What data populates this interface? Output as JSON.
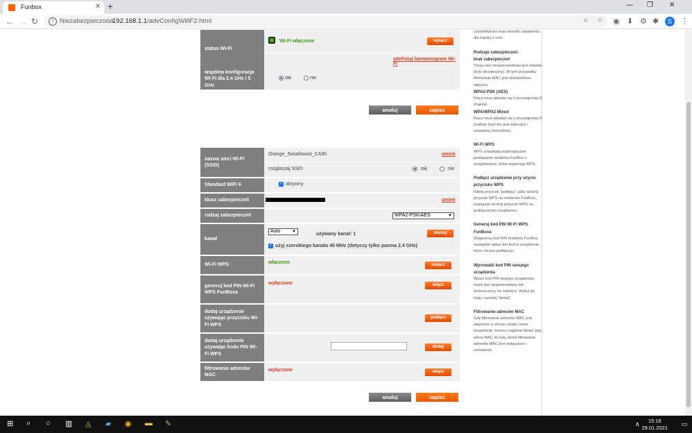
{
  "browser": {
    "tab_title": "Funbox",
    "tab_close": "✕",
    "new_tab": "+",
    "insecure_label": "Niezabezpieczona",
    "url_host": "192.168.1.1",
    "url_path": "/advConfigWifiF2.html"
  },
  "section1": {
    "status_label": "status Wi-Fi",
    "status_value": "Wi-Fi włączone",
    "status_button": "wyłącz",
    "schedule_link": "zdefiniuj harmonogram Wi-Fi",
    "common_label": "wspólna konfiguracja Wi-Fi dla 2.4 GHz i 5 GHz",
    "radio_yes": "tak",
    "radio_no": "nie",
    "cancel": "anuluj",
    "save": "zapisz"
  },
  "section2": {
    "ssid_label": "nazwa sieci Wi-Fi (SSID)",
    "ssid_value": "Orange_Swiatlowod_CA90",
    "ssid_change": "zmień",
    "broadcast_label": "rozgłaszaj SSID",
    "broadcast_yes": "tak",
    "broadcast_no": "nie",
    "wifi6_label": "Standard WiFi 6",
    "wifi6_value": "aktywny",
    "key_label": "klucz zabezpieczeń",
    "key_change": "zmień",
    "sec_type_label": "rodzaj zabezpieczeń",
    "sec_type_value": "WPA2-PSK/AES",
    "channel_label": "kanał",
    "channel_value": "Auto",
    "channel_used": "używany kanał: 1",
    "scan_button": "skanuj",
    "wide_channel": "użyj szerokiego kanału 40 MHz (dotyczy tylko pasma 2.4 GHz)",
    "wps_label": "Wi-Fi WPS",
    "wps_value": "włączone",
    "wps_button": "wyłącz",
    "pin_label": "generuj kod PIN Wi-Fi WPS FunBoxa",
    "pin_value": "wyłączone",
    "pin_button": "włącz",
    "add_btn_label": "dodaj urządzenie używając przycisku Wi-Fi WPS",
    "add_btn_button": "podłącz",
    "add_pin_label": "dodaj urządzenie używając kodu PIN Wi-Fi WPS",
    "add_pin_button": "dodaj",
    "mac_label": "filtrowanie adresów MAC",
    "mac_value": "wyłączone",
    "mac_button": "włącz",
    "cancel": "anuluj",
    "save": "zapisz"
  },
  "help": {
    "intro": "wybrać, czy chcesz mieć dostępne obie częstotliwości oraz określić ustawienia dla każdej z nich.",
    "sec_title": "Rodzaje zabezpieczeń:",
    "none_title": "brak zabezpieczeń",
    "none_text": "Twoja sieć bezprzewodowa jest otwarta (tryb niezalecany). W tym przypadku filtrowanie MAC jest standardowo włączon.",
    "wpa2_title": "WPA2-PSK (AES)",
    "wpa2_text": "Klucz musi składać się z przynajmniej 8 znaków.",
    "mixed_title": "WPA/WPA2 Mixed",
    "mixed_text": "Klucz musi składać się z przynajmniej 8 znaków (tryb ten jest zalecany i ustawiony domyślnie).",
    "wps_title": "Wi-Fi WPS",
    "wps_text": "WPS umożliwia automatyczne powiązanie modemu FunBox z urządzeniami, które wspierają WPS.",
    "connect_title": "Podłącz urządzenie przy użyciu przycisku WPS",
    "connect_text": "Kliknij przycisk \"podłącz\" (albo wciśnij przycisk WPS na modemie FunBox), następnie wciśnij przycisk WPS na podłączanym urządzeniu.",
    "genpin_title": "Generuj kod PIN Wi-Fi WPS FunBoxa",
    "genpin_text": "Wygeneruj kod PIN modemu FunBox, następnie wpisz ten kod w urządzeniu, które chcesz podłączyć.",
    "enterpin_title": "Wprowadź kod PIN swojego urządzenia",
    "enterpin_text": "Wpisz kod PIN twojego urządzenia: może być wygenerowany lub umieszczony na naklejce. Wpisz go tutaj i naciśnij \"dodaj\".",
    "mac_title": "Filtrowanie adresów MAC",
    "mac_text": "Gdy filtrowanie adresów MAC jest włączone a chcesz dodać nowe urządzenie, musisz najpierw dodać jego adres MAC do listy.Jeżeli filtrowanie adresów MAC jest wyłączone i ustawienie"
  },
  "taskbar": {
    "time": "15:16",
    "date": "29.01.2021"
  },
  "colors": {
    "accent": "#ff6600",
    "label_bg": "#7f7f7f",
    "status_on": "#3a9b10",
    "status_off": "#e2401c"
  }
}
